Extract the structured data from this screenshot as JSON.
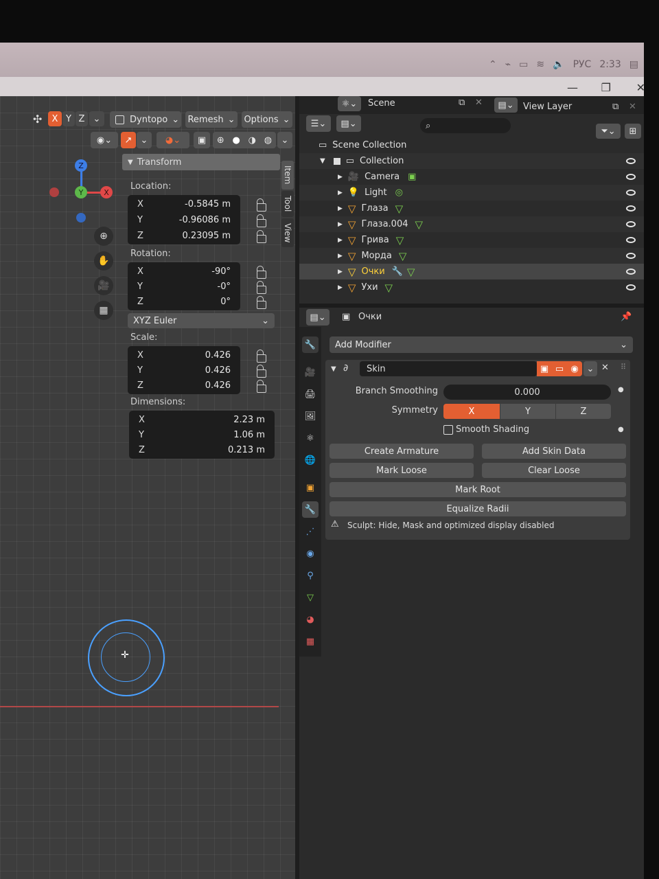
{
  "system": {
    "tray_lang": "РУС",
    "tray_time": "2:33",
    "min_glyph": "—",
    "max_glyph": "❐",
    "close_glyph": "✕"
  },
  "viewport_header": {
    "axes": [
      "X",
      "Y",
      "Z"
    ],
    "dyntopo": "Dyntopo",
    "remesh": "Remesh",
    "options": "Options"
  },
  "transform_panel": {
    "title": "Transform",
    "location_label": "Location:",
    "location": {
      "x": "-0.5845 m",
      "y": "-0.96086 m",
      "z": "0.23095 m"
    },
    "rotation_label": "Rotation:",
    "rotation": {
      "x": "-90°",
      "y": "-0°",
      "z": "0°"
    },
    "rotation_mode": "XYZ Euler",
    "scale_label": "Scale:",
    "scale": {
      "x": "0.426",
      "y": "0.426",
      "z": "0.426"
    },
    "dimensions_label": "Dimensions:",
    "dimensions": {
      "x": "2.23 m",
      "y": "1.06 m",
      "z": "0.213 m"
    },
    "axis_x": "X",
    "axis_y": "Y",
    "axis_z": "Z"
  },
  "sidebar_tabs": [
    "Item",
    "Tool",
    "View"
  ],
  "outliner": {
    "scene": "Scene",
    "view_layer": "View Layer",
    "search_placeholder": "",
    "scene_collection": "Scene Collection",
    "collection": "Collection",
    "items": [
      {
        "name": "Camera"
      },
      {
        "name": "Light"
      },
      {
        "name": "Глаза"
      },
      {
        "name": "Глаза.004"
      },
      {
        "name": "Грива"
      },
      {
        "name": "Морда"
      },
      {
        "name": "Очки"
      },
      {
        "name": "Ухи"
      }
    ]
  },
  "properties": {
    "object_name": "Очки",
    "add_modifier": "Add Modifier",
    "modifier_name": "Skin",
    "branch_smoothing_label": "Branch Smoothing",
    "branch_smoothing_value": "0.000",
    "symmetry_label": "Symmetry",
    "symmetry": [
      "X",
      "Y",
      "Z"
    ],
    "smooth_shading": "Smooth Shading",
    "create_armature": "Create Armature",
    "add_skin_data": "Add Skin Data",
    "mark_loose": "Mark Loose",
    "clear_loose": "Clear Loose",
    "mark_root": "Mark Root",
    "equalize_radii": "Equalize Radii",
    "warning": "Sculpt: Hide, Mask and optimized display disabled"
  },
  "colors": {
    "accent_orange": "#e35f32",
    "object_orange": "#f1a233",
    "mesh_green": "#7ccf4f",
    "selected_text": "#ffd23a"
  }
}
